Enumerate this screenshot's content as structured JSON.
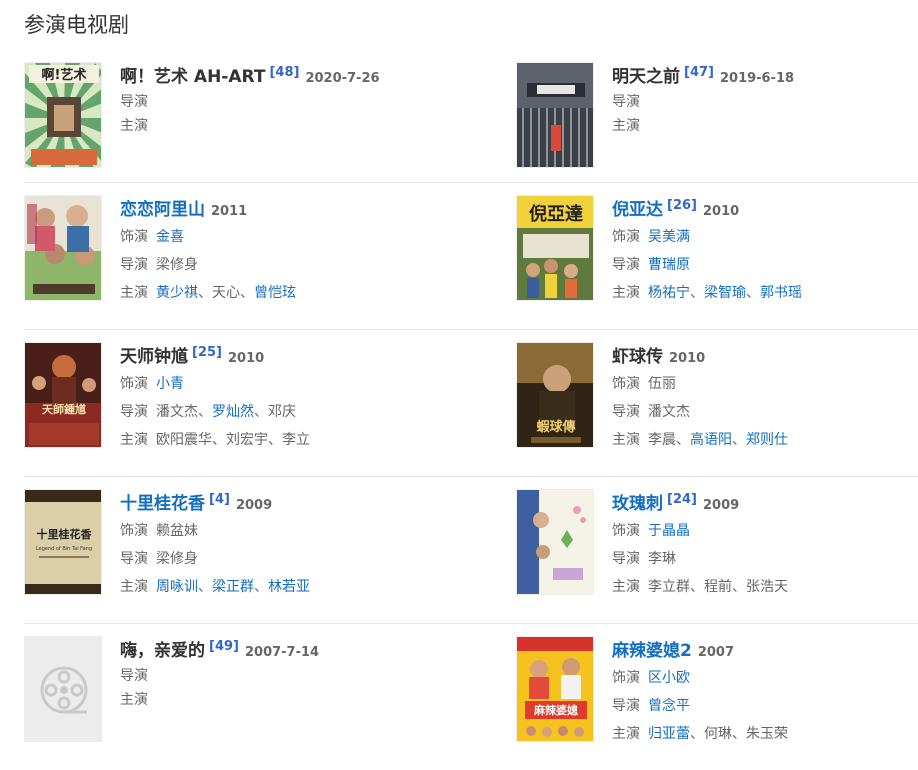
{
  "section": {
    "title": "参演电视剧"
  },
  "rows": [
    {
      "left": {
        "title": "啊！艺术 AH-ART",
        "ref": "[48]",
        "year": "2020-7-26",
        "director": "导演",
        "lead": "主演"
      },
      "right": {
        "title": "明天之前",
        "ref": "[47]",
        "year": "2019-6-18",
        "director": "导演",
        "lead": "主演"
      }
    },
    {
      "left": {
        "title": "恋恋阿里山",
        "year": "2011",
        "role_label": "饰演",
        "role": "金喜",
        "director_label": "导演",
        "director": "梁修身",
        "lead_label": "主演",
        "leads": [
          "黄少祺",
          "天心",
          "曾恺玹"
        ]
      },
      "right": {
        "title": "倪亚达",
        "ref": "[26]",
        "year": "2010",
        "role_label": "饰演",
        "role": "吴美满",
        "director_label": "导演",
        "director": "曹瑞原",
        "lead_label": "主演",
        "leads": [
          "杨祐宁",
          "梁智瑜",
          "郭书瑶"
        ]
      }
    },
    {
      "left": {
        "title": "天师钟馗",
        "ref": "[25]",
        "year": "2010",
        "role_label": "饰演",
        "role": "小青",
        "director_label": "导演",
        "directors": [
          "潘文杰",
          "罗灿然",
          "邓庆"
        ],
        "lead_label": "主演",
        "leads": [
          "欧阳震华",
          "刘宏宇",
          "李立"
        ]
      },
      "right": {
        "title": "虾球传",
        "year": "2010",
        "role_label": "饰演",
        "role": "伍丽",
        "director_label": "导演",
        "director": "潘文杰",
        "lead_label": "主演",
        "leads": [
          "李晨",
          "高语阳",
          "郑则仕"
        ]
      }
    },
    {
      "left": {
        "title": "十里桂花香",
        "ref": "[4]",
        "year": "2009",
        "role_label": "饰演",
        "role": "赖盆妹",
        "director_label": "导演",
        "director": "梁修身",
        "lead_label": "主演",
        "leads": [
          "周咏训",
          "梁正群",
          "林若亚"
        ]
      },
      "right": {
        "title": "玫瑰刺",
        "ref": "[24]",
        "year": "2009",
        "role_label": "饰演",
        "role": "于晶晶",
        "director_label": "导演",
        "director": "李琳",
        "lead_label": "主演",
        "leads": [
          "李立群",
          "程前",
          "张浩天"
        ]
      }
    },
    {
      "left": {
        "title": "嗨，亲爱的",
        "ref": "[49]",
        "year": "2007-7-14",
        "director": "导演",
        "lead": "主演"
      },
      "right": {
        "title": "麻辣婆媳2",
        "year": "2007",
        "role_label": "饰演",
        "role": "区小欧",
        "director_label": "导演",
        "director": "曾念平",
        "lead_label": "主演",
        "leads": [
          "归亚蕾",
          "何琳",
          "朱玉荣"
        ]
      }
    }
  ],
  "poster_texts": {
    "r0l": "啊!艺术",
    "r1r": "倪亞達",
    "r2l": "天師鍾馗",
    "r2r": "蝦球傳",
    "r3l": "十里桂花香",
    "r3l_sub": "Legend of Bin Tai Fang",
    "r4r": "麻辣婆媳"
  }
}
